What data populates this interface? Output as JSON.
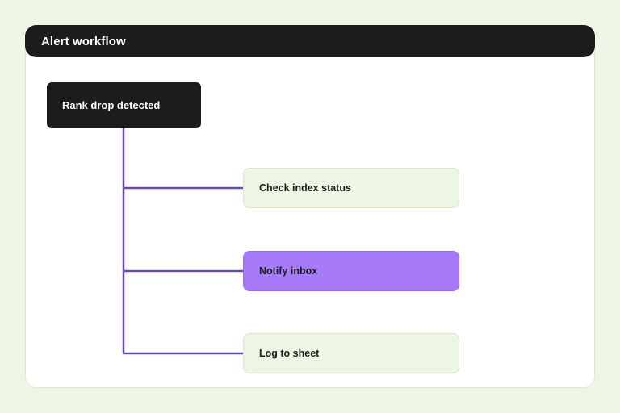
{
  "header": {
    "title": "Alert workflow"
  },
  "trigger": {
    "label": "Rank drop detected"
  },
  "steps": [
    {
      "label": "Check index status",
      "style": "normal"
    },
    {
      "label": "Notify inbox",
      "style": "highlight"
    },
    {
      "label": "Log to sheet",
      "style": "normal"
    }
  ],
  "colors": {
    "background": "#eef6e6",
    "dark": "#1c1c1c",
    "connector": "#6a4aa8",
    "step_fill": "#edf6e3",
    "highlight_fill": "#a77bf7"
  }
}
